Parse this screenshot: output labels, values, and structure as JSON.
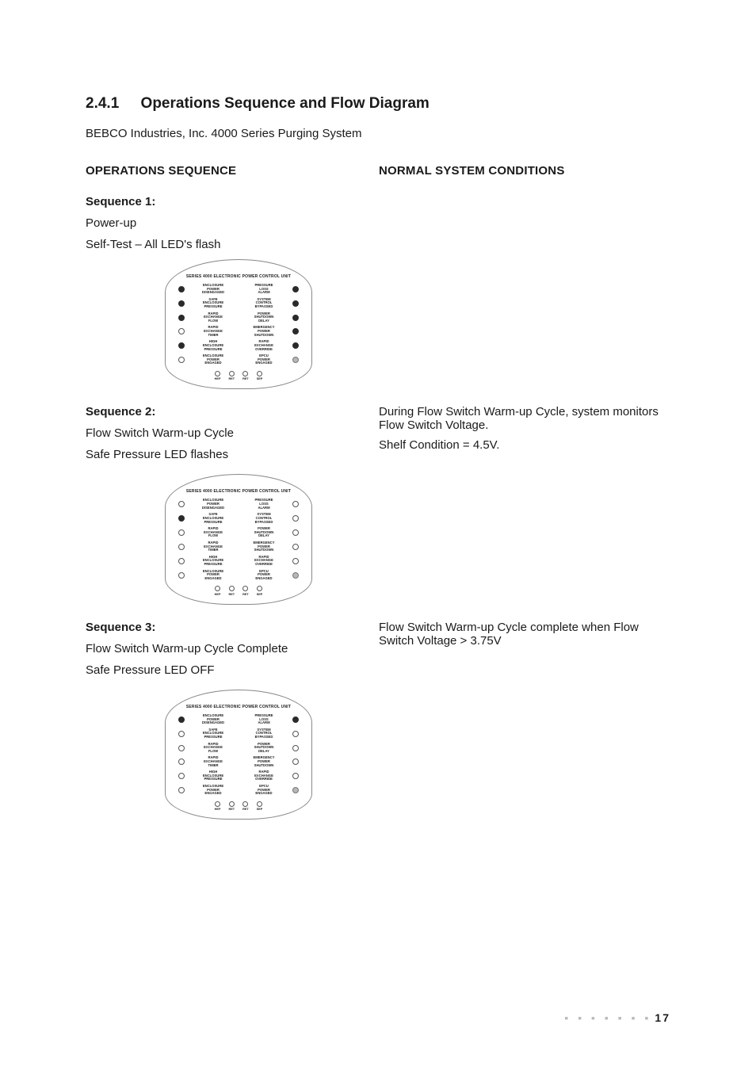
{
  "section": {
    "number": "2.4.1",
    "title": "Operations Sequence and Flow Diagram",
    "subtitle": "BEBCO Industries, Inc. 4000 Series Purging System"
  },
  "columns": {
    "left_header": "OPERATIONS SEQUENCE",
    "right_header": "NORMAL SYSTEM CONDITIONS"
  },
  "panel": {
    "title": "SERIES 4000 ELECTRONIC POWER CONTROL UNIT",
    "left_labels": [
      "ENCLOSURE\nPOWER\nDISENGAGED",
      "SAFE\nENCLOSURE\nPRESSURE",
      "RAPID\nEXCHANGE\nFLOW",
      "RAPID\nEXCHANGE\nTIMER",
      "HIGH\nENCLOSURE\nPRESSURE",
      "ENCLOSURE\nPOWER\nENGAGED"
    ],
    "right_labels": [
      "PRESSURE\nLOSS\nALARM",
      "SYSTEM\nCONTROL\nBYPASSED",
      "POWER\nSHUTDOWN\nDELAY",
      "EMERGENCY\nPOWER\nSHUTDOWN",
      "RAPID\nEXCHANGE\nOVERRIDE",
      "EPCU\nPOWER\nENGAGED"
    ],
    "bottom": [
      "HEP",
      "RET",
      "RET",
      "SEP"
    ]
  },
  "sequences": [
    {
      "title": "Sequence 1:",
      "lines": [
        "Power-up",
        "Self-Test – All LED's flash"
      ],
      "right_lines": [],
      "leds": {
        "left": [
          "on",
          "on",
          "on",
          "off",
          "on",
          "off"
        ],
        "right": [
          "on",
          "on",
          "on",
          "on",
          "on",
          "grey"
        ]
      }
    },
    {
      "title": "Sequence 2:",
      "lines": [
        "Flow Switch Warm-up Cycle",
        "Safe Pressure LED flashes"
      ],
      "right_lines": [
        "During Flow Switch Warm-up Cycle, system monitors Flow Switch Voltage.",
        "Shelf Condition = 4.5V."
      ],
      "leds": {
        "left": [
          "off",
          "on",
          "off",
          "off",
          "off",
          "off"
        ],
        "right": [
          "off",
          "off",
          "off",
          "off",
          "off",
          "grey"
        ]
      }
    },
    {
      "title": "Sequence 3:",
      "lines": [
        "Flow Switch Warm-up Cycle Complete",
        "Safe Pressure LED OFF"
      ],
      "right_lines": [
        "Flow Switch Warm-up Cycle complete when Flow Switch Voltage > 3.75V"
      ],
      "leds": {
        "left": [
          "on",
          "off",
          "off",
          "off",
          "off",
          "off"
        ],
        "right": [
          "on",
          "off",
          "off",
          "off",
          "off",
          "grey"
        ]
      }
    }
  ],
  "page_number": "17"
}
